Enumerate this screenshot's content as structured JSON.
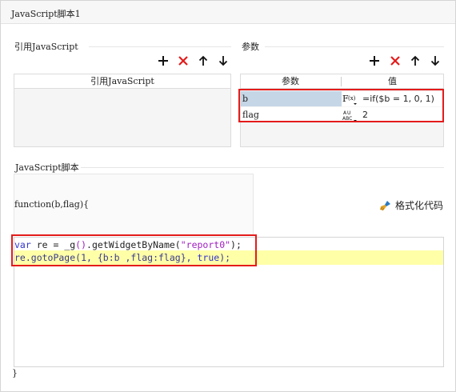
{
  "window": {
    "title": "JavaScript脚本1"
  },
  "ref_section": {
    "label": "引用JavaScript",
    "table_header": "引用JavaScript",
    "toolbar": {
      "add_icon": "plus-icon",
      "delete_icon": "close-icon",
      "up_icon": "arrow-up-icon",
      "down_icon": "arrow-down-icon"
    }
  },
  "params_section": {
    "label": "参数",
    "columns": [
      "参数",
      "值"
    ],
    "rows": [
      {
        "name": "b",
        "type_icon": "formula-icon",
        "value": "=if($b = 1, 0, 1)"
      },
      {
        "name": "flag",
        "type_icon": "text-type-icon",
        "value": "2"
      }
    ],
    "selected_row_color": "#c5d6e6"
  },
  "script_section": {
    "label": "JavaScript脚本",
    "function_signature": "function(b,flag){",
    "closing_brace": "}",
    "format_button": "格式化代码",
    "code": {
      "line1": {
        "kw": "var",
        "text1": " re = _g",
        "paren": "()",
        "text2": ".getWidgetByName(",
        "str": "\"report0\"",
        "text3": ");"
      },
      "line2": {
        "text1": "re.gotoPage(1, {b:b ,flag:flag}, ",
        "kw": "true",
        "text2": ");"
      }
    },
    "highlight_color": "#ffffa8"
  },
  "colors": {
    "accent_red": "#e41b1b",
    "keyword_blue": "#3333cc",
    "string_purple": "#a020c0"
  }
}
